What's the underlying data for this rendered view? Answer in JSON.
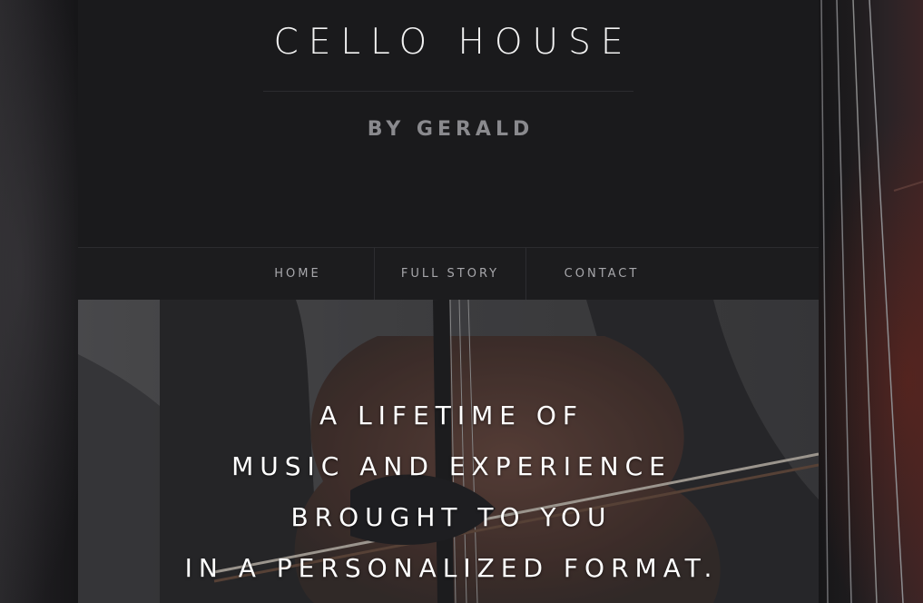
{
  "header": {
    "title": "CELLO HOUSE",
    "subtitle": "BY GERALD"
  },
  "nav": {
    "items": [
      {
        "label": "HOME"
      },
      {
        "label": "FULL STORY"
      },
      {
        "label": "CONTACT"
      }
    ]
  },
  "hero": {
    "lines": [
      "A LIFETIME OF",
      "MUSIC AND EXPERIENCE",
      "BROUGHT TO YOU",
      "IN A PERSONALIZED FORMAT."
    ]
  },
  "colors": {
    "page_background": "#1a1a1c",
    "title_text": "#f2f2f2",
    "subtitle_text": "#8a8a8e",
    "nav_text": "#a7a7ab",
    "hero_text": "#ffffff"
  }
}
